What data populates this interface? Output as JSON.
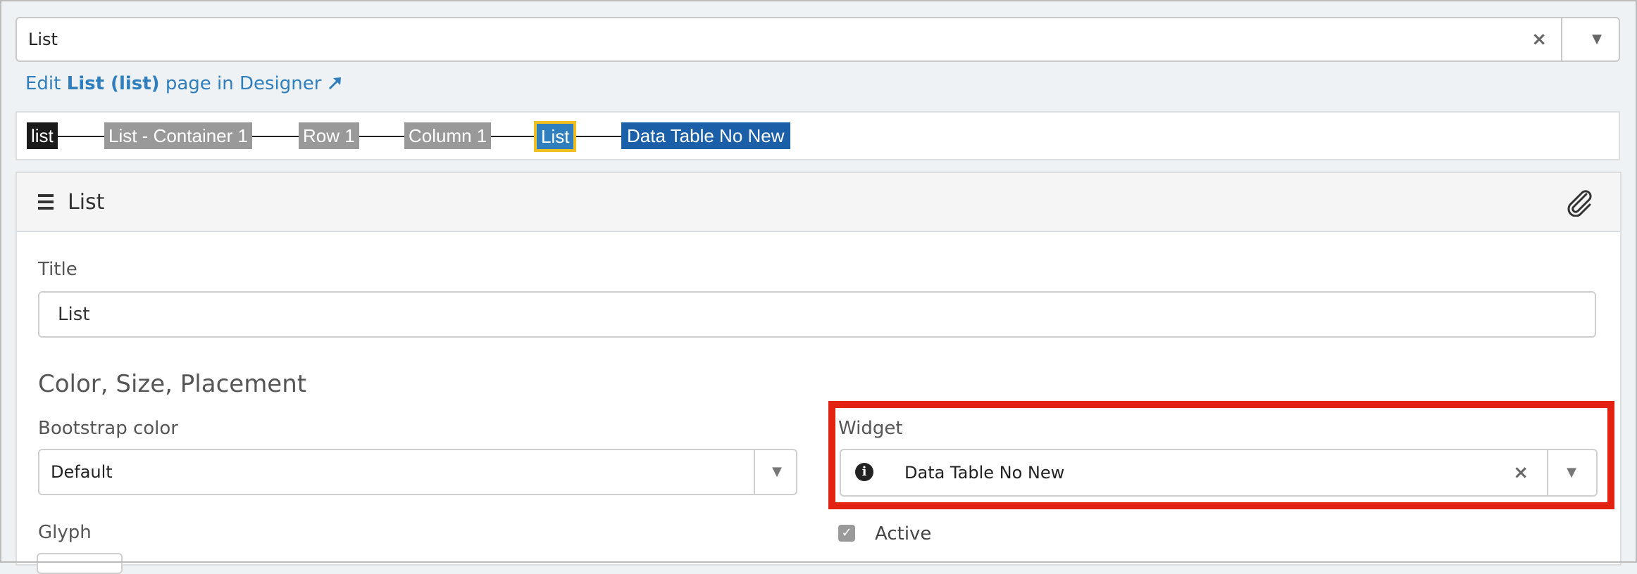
{
  "top_select": {
    "value": "List",
    "clear_glyph": "×",
    "arrow_glyph": "▼"
  },
  "designer_link": {
    "prefix": "Edit",
    "name": "List (list)",
    "suffix": "page in Designer",
    "icon": "external-link-icon"
  },
  "breadcrumb": {
    "items": [
      "list",
      "List - Container 1",
      "Row 1",
      "Column 1",
      "List",
      "Data Table No New"
    ],
    "active_index": 4
  },
  "panel": {
    "header": {
      "title": "List",
      "menu_icon": "hamburger-icon",
      "attach_icon": "paperclip-icon"
    },
    "title_label": "Title",
    "title_value": "List",
    "section_heading": "Color, Size, Placement",
    "bootstrap_color": {
      "label": "Bootstrap color",
      "value": "Default"
    },
    "widget": {
      "label": "Widget",
      "value": "Data Table No New",
      "icon": "info-icon"
    },
    "glyph_label": "Glyph",
    "active": {
      "label": "Active",
      "checked": true
    }
  },
  "colors": {
    "link": "#2f7fbf",
    "highlight": "#e32212",
    "crumb_active_outline": "#f0c020",
    "crumb_widget": "#1a5fa8"
  }
}
